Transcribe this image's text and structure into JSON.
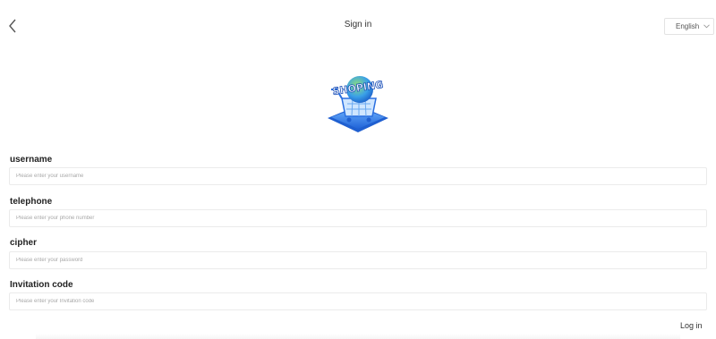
{
  "header": {
    "title": "Sign in",
    "language": "English",
    "back_icon": "chevron-left-icon",
    "dropdown_icon": "chevron-down-icon"
  },
  "logo": {
    "text": "SHOPING",
    "icon": "shopping-cart-globe-logo"
  },
  "form": {
    "username": {
      "label": "username",
      "placeholder": "Please enter your username",
      "value": ""
    },
    "telephone": {
      "label": "telephone",
      "placeholder": "Please enter your phone number",
      "value": ""
    },
    "cipher": {
      "label": "cipher",
      "placeholder": "Please enter your password",
      "value": ""
    },
    "invitation": {
      "label": "Invitation code",
      "placeholder": "Please enter your Invitation code",
      "value": ""
    }
  },
  "actions": {
    "login_label": "Log in"
  },
  "colors": {
    "accent": "#2f7fe6",
    "border": "#ebebeb",
    "placeholder": "#a8a8a8"
  }
}
